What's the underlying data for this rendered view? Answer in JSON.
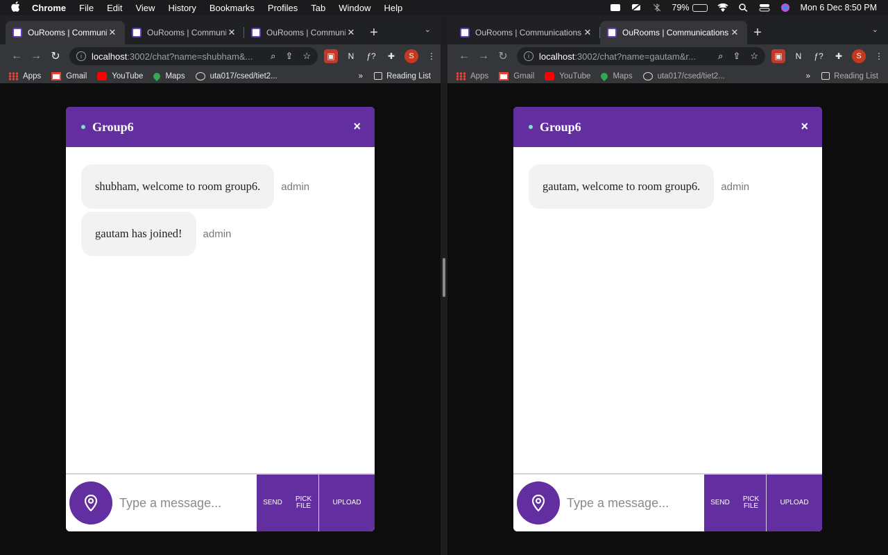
{
  "menubar": {
    "app": "Chrome",
    "items": [
      "File",
      "Edit",
      "View",
      "History",
      "Bookmarks",
      "Profiles",
      "Tab",
      "Window",
      "Help"
    ],
    "battery": "79%",
    "battery_level": 0.79,
    "datetime": "Mon 6 Dec  8:50 PM"
  },
  "windows": [
    {
      "tabs": [
        {
          "title": "OuRooms | Communications"
        },
        {
          "title": "OuRooms | Communications"
        },
        {
          "title": "OuRooms | Communications"
        }
      ],
      "active_tab": 0,
      "url_host": "localhost",
      "url_rest": ":3002/chat?name=shubham&...",
      "bookmarks": {
        "items": [
          "Apps",
          "Gmail",
          "YouTube",
          "Maps",
          "uta017/csed/tiet2..."
        ],
        "more": "»",
        "reading_list": "Reading List"
      },
      "chat": {
        "room_name": "Group6",
        "close_label": "×",
        "messages": [
          {
            "text": "shubham, welcome to room group6.",
            "sender": "admin"
          },
          {
            "text": "gautam has joined!",
            "sender": "admin"
          }
        ],
        "input_placeholder": "Type a message...",
        "send_label": "SEND",
        "pick_label_line1": "PICK",
        "pick_label_line2": "FILE",
        "upload_label": "UPLOAD"
      }
    },
    {
      "tabs": [
        {
          "title": "OuRooms | Communications"
        },
        {
          "title": "OuRooms | Communications"
        }
      ],
      "active_tab": 1,
      "url_host": "localhost",
      "url_rest": ":3002/chat?name=gautam&r...",
      "bookmarks": {
        "items": [
          "Apps",
          "Gmail",
          "YouTube",
          "Maps",
          "uta017/csed/tiet2..."
        ],
        "more": "»",
        "reading_list": "Reading List"
      },
      "chat": {
        "room_name": "Group6",
        "close_label": "×",
        "messages": [
          {
            "text": "gautam, welcome to room group6.",
            "sender": "admin"
          }
        ],
        "input_placeholder": "Type a message...",
        "send_label": "SEND",
        "pick_label_line1": "PICK",
        "pick_label_line2": "FILE",
        "upload_label": "UPLOAD"
      }
    }
  ]
}
